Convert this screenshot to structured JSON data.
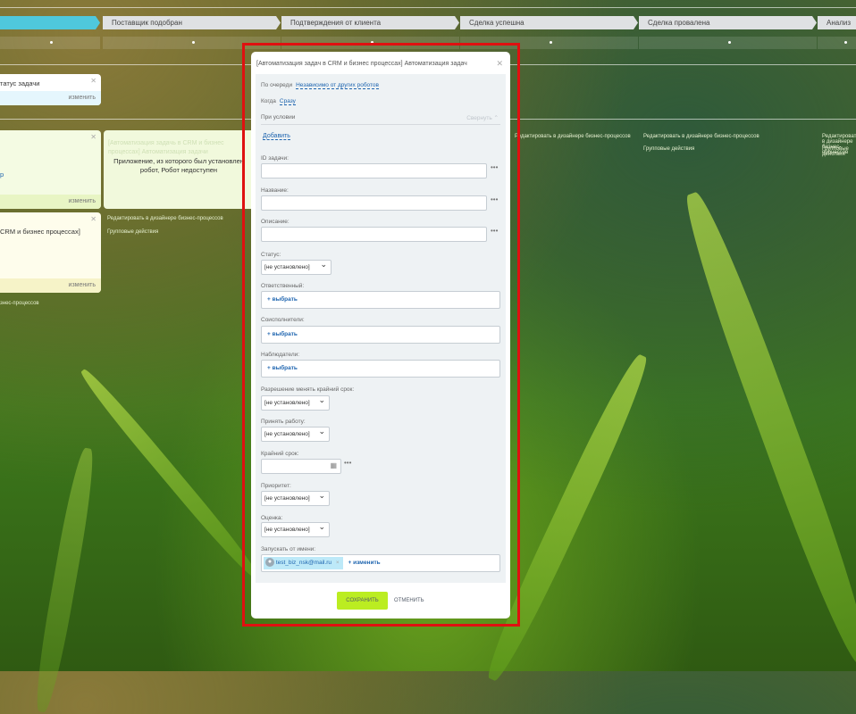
{
  "stages": [
    "Поставщик подобран",
    "Подтверждения от клиента",
    "Сделка успешна",
    "Сделка провалена",
    "Анализ причин"
  ],
  "cards": {
    "card1_text": "татус задачи",
    "change": "изменить",
    "card2_text": "р",
    "card3_text": "CRM и бизнес процессах]",
    "unavailable_text": "Приложение, из которого был установлен робот, Робот недоступен",
    "faded_text": "[Автоматизация задачь в CRM и бизнес процессах] Автоматизация задачи"
  },
  "links": {
    "edit_designer": "Редактировать в дизайнере бизнес-процессов",
    "group_actions": "Групповые действия",
    "edit_designer_short": "знес-процессов"
  },
  "modal": {
    "title": "[Автоматизация задач в CRM и бизнес процессах] Автоматизация задач",
    "queue_label": "По очереди",
    "queue_value": "Независимо от других роботов",
    "when_label": "Когда",
    "when_value": "Сразу",
    "condition_label": "При условии",
    "collapse": "Свернуть",
    "add": "Добавить",
    "fields": {
      "task_id": "ID задачи:",
      "name": "Название:",
      "description": "Описание:",
      "status": "Статус:",
      "responsible": "Ответственный:",
      "coexecutors": "Соисполнители:",
      "observers": "Наблюдатели:",
      "deadline_change": "Разрешение менять крайний срок:",
      "accept_work": "Принять работу:",
      "deadline": "Крайний срок:",
      "priority": "Приоритет:",
      "rating": "Оценка:",
      "run_as": "Запускать от имени:"
    },
    "not_set": "[не установлено]",
    "choose": "+ выбрать",
    "user": "test_biz_nsk@mail.ru",
    "change": "+ изменить",
    "save": "СОХРАНИТЬ",
    "cancel": "ОТМЕНИТЬ"
  }
}
